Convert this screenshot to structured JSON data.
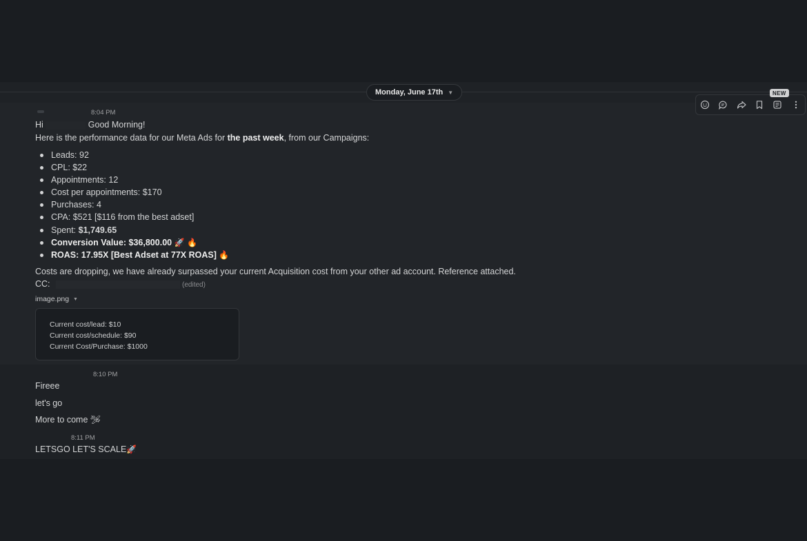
{
  "date_divider": {
    "label": "Monday, June 17th",
    "chevron_icon": "chevron-down-icon"
  },
  "toolbar": {
    "new_badge": "NEW",
    "icons": [
      "add-reaction-icon",
      "reply-in-thread-icon",
      "forward-icon",
      "bookmark-icon",
      "save-for-later-icon",
      "more-actions-icon"
    ]
  },
  "message1": {
    "time": "8:04 PM",
    "greeting_hi": "Hi",
    "greeting_rest": "Good Morning!",
    "intro_before": "Here is the performance data for our Meta Ads for ",
    "intro_bold": "the past week",
    "intro_after": ", from our Campaigns:",
    "bullets": {
      "leads": "Leads: 92",
      "cpl": "CPL: $22",
      "appointments": "Appointments: 12",
      "cost_per_appt": "Cost per appointments: $170",
      "purchases": "Purchases: 4",
      "cpa": "CPA: $521 [$116 from the best adset]",
      "spent_label": "Spent: ",
      "spent_value": "$1,749.65",
      "conversion": "Conversion Value: $36,800.00",
      "roas": "ROAS: 17.95X [Best Adset at 77X ROAS]"
    },
    "emoji": {
      "rocket": "🚀",
      "fire": "🔥"
    },
    "closing": "Costs are dropping, we have already surpassed your current Acquisition cost from your other ad account.  Reference attached.",
    "cc_label": "CC:",
    "edited_label": "(edited)",
    "file_name": "image.png",
    "attachment_lines": {
      "lead": "Current cost/lead: $10",
      "schedule": "Current cost/schedule: $90",
      "purchase": "Current Cost/Purchase: $1000"
    }
  },
  "message2": {
    "time": "8:10 PM",
    "line1": "Fireee",
    "line2": "let's go",
    "line3": "More to come",
    "line3_emoji": "🛩"
  },
  "message3": {
    "time": "8:11 PM",
    "text": "LETSGO LET'S SCALE",
    "emoji": "🚀"
  }
}
